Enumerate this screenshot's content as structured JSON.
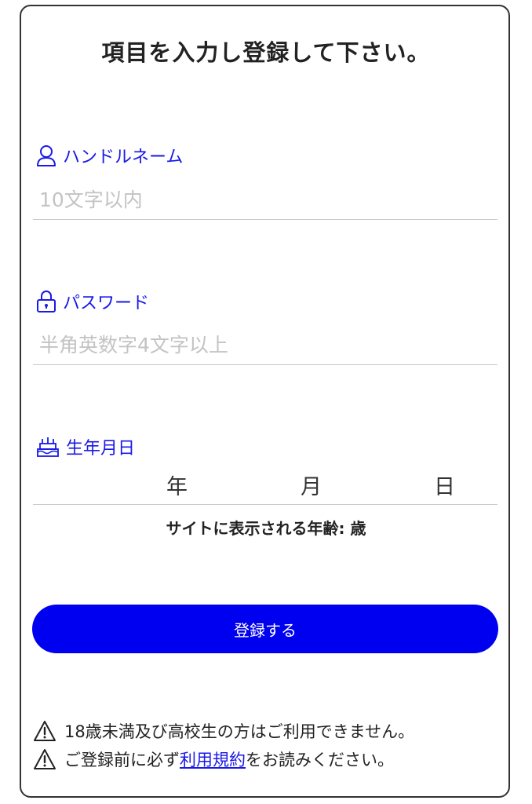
{
  "form": {
    "title": "項目を入力し登録して下さい。",
    "handle": {
      "label": "ハンドルネーム",
      "placeholder": "10文字以内",
      "icon": "user-icon"
    },
    "password": {
      "label": "パスワード",
      "placeholder": "半角英数字4文字以上",
      "icon": "lock-icon"
    },
    "birthday": {
      "label": "生年月日",
      "icon": "cake-icon",
      "year_unit": "年",
      "month_unit": "月",
      "day_unit": "日"
    },
    "age_label": "サイトに表示される年齢:",
    "age_unit": "歳",
    "submit_label": "登録する"
  },
  "notices": {
    "icon": "warning-icon",
    "line1": "18歳未満及び高校生の方はご利用できません。",
    "line2_prefix": "ご登録前に必ず",
    "line2_link": "利用規約",
    "line2_suffix": "をお読みください。"
  },
  "colors": {
    "accent": "#1a1ae6",
    "button": "#0000f0",
    "placeholder": "#c3c3c3"
  }
}
